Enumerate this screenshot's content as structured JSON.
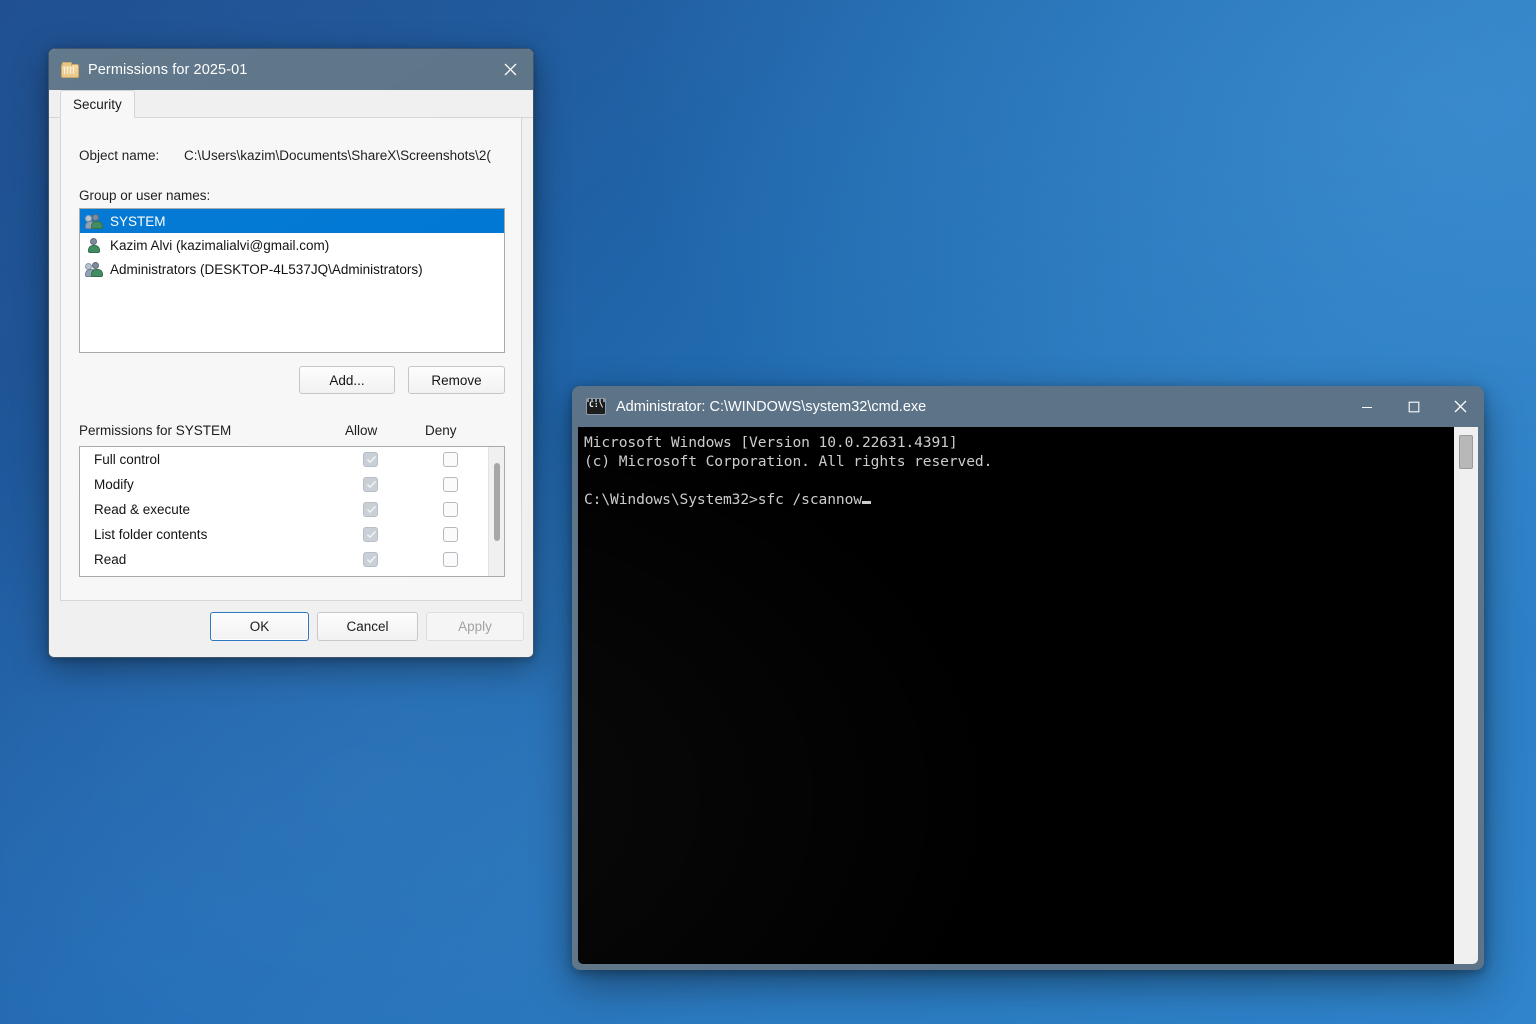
{
  "desktop": {
    "background_top_left": "#184a8c",
    "background_bottom_right": "#2f84cb"
  },
  "permissions_dialog": {
    "title": "Permissions for 2025-01",
    "title_icon": "folder-icon",
    "close_icon": "close-icon",
    "tabs": [
      {
        "label": "Security",
        "active": true
      }
    ],
    "object_name_label": "Object name:",
    "object_name_value": "C:\\Users\\kazim\\Documents\\ShareX\\Screenshots\\2(",
    "group_label": "Group or user names:",
    "group_list": [
      {
        "name": "SYSTEM",
        "icon": "users-group-icon",
        "selected": true
      },
      {
        "name": "Kazim Alvi (kazimalialvi@gmail.com)",
        "icon": "user-icon",
        "selected": false
      },
      {
        "name": "Administrators (DESKTOP-4L537JQ\\Administrators)",
        "icon": "users-group-icon",
        "selected": false
      }
    ],
    "add_button": "Add...",
    "remove_button": "Remove",
    "permissions_header": "Permissions for SYSTEM",
    "allow_column": "Allow",
    "deny_column": "Deny",
    "permission_rows": [
      {
        "name": "Full control",
        "allow": true,
        "deny": false
      },
      {
        "name": "Modify",
        "allow": true,
        "deny": false
      },
      {
        "name": "Read & execute",
        "allow": true,
        "deny": false
      },
      {
        "name": "List folder contents",
        "allow": true,
        "deny": false
      },
      {
        "name": "Read",
        "allow": true,
        "deny": false
      },
      {
        "name": "",
        "allow": true,
        "deny": false
      }
    ],
    "ok_button": "OK",
    "cancel_button": "Cancel",
    "apply_button": "Apply",
    "apply_disabled": true,
    "selection_color": "#0078d4",
    "titlebar_color": "#5d7488"
  },
  "cmd_window": {
    "title": "Administrator: C:\\WINDOWS\\system32\\cmd.exe",
    "title_icon": "cmd-icon",
    "minimize_icon": "minimize-icon",
    "maximize_icon": "maximize-icon",
    "close_icon": "close-icon",
    "titlebar_color": "#5d7488",
    "console_background": "#000000",
    "console_foreground": "#cccccc",
    "console_lines": [
      "Microsoft Windows [Version 10.0.22631.4391]",
      "(c) Microsoft Corporation. All rights reserved.",
      "",
      "C:\\Windows\\System32>sfc /scannow"
    ]
  }
}
